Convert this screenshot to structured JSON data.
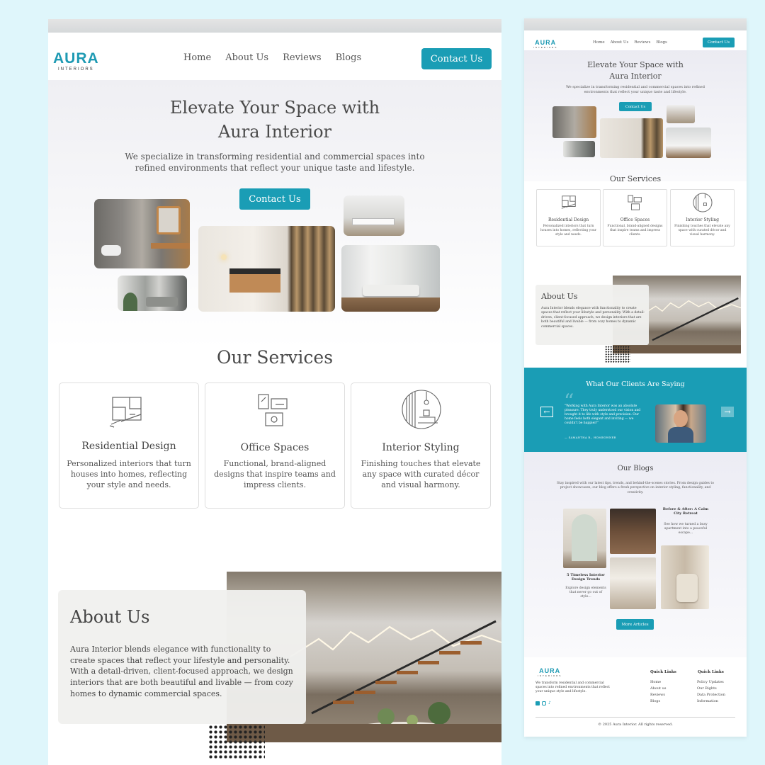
{
  "brand": {
    "name": "AURA",
    "tagline": "INTERIORS",
    "accent": "#1a9db5"
  },
  "nav": {
    "links": [
      "Home",
      "About Us",
      "Reviews",
      "Blogs"
    ],
    "cta": "Contact Us"
  },
  "hero": {
    "title_line1": "Elevate Your Space with",
    "title_line2": "Aura Interior",
    "subtitle": "We specialize in transforming residential and commercial spaces into refined environments that reflect your unique taste and lifestyle.",
    "cta": "Contact Us"
  },
  "services": {
    "title": "Our Services",
    "items": [
      {
        "icon": "floorplan-icon",
        "title": "Residential Design",
        "desc": "Personalized interiors that turn houses into homes, reflecting your style and needs."
      },
      {
        "icon": "office-furniture-icon",
        "title": "Office Spaces",
        "desc": "Functional, brand-aligned designs that inspire teams and impress clients."
      },
      {
        "icon": "styled-room-icon",
        "title": "Interior Styling",
        "desc": "Finishing touches that elevate any space with curated décor and visual harmony."
      }
    ]
  },
  "about": {
    "title": "About Us",
    "text": "Aura Interior blends elegance with functionality to create spaces that reflect your lifestyle and personality. With a detail-driven, client-focused approach, we design interiors that are both beautiful and livable — from cozy homes to dynamic commercial spaces."
  },
  "testimonials": {
    "title": "What Our Clients Are Saying",
    "quote": "\"Working with Aura Interior was an absolute pleasure. They truly understood our vision and brought it to life with style and precision. Our home feels both elegant and inviting — we couldn't be happier!\"",
    "author": "— SAMANTHA R., HOMEOWNER",
    "prev_icon": "arrow-left-icon",
    "next_icon": "arrow-right-icon"
  },
  "blogs": {
    "title": "Our Blogs",
    "intro": "Stay inspired with our latest tips, trends, and behind-the-scenes stories. From design guides to project showcases, our blog offers a fresh perspective on interior styling, functionality, and creativity.",
    "posts": [
      {
        "title": "5 Timeless Interior Design Trends",
        "desc": "Explore design elements that never go out of style..."
      },
      {
        "title": "Before & After: A Calm City Retreat",
        "desc": "See how we turned a busy apartment into a peaceful escape..."
      }
    ],
    "cta": "More Articles"
  },
  "footer": {
    "desc": "We transform residential and commercial spaces into refined environments that reflect your unique style and lifestyle.",
    "col1": {
      "title": "Quick Links",
      "links": [
        "Home",
        "About us",
        "Reviews",
        "Blogs"
      ]
    },
    "col2": {
      "title": "Quick Links",
      "links": [
        "Policy Updates",
        "Our Rights",
        "Data Protection",
        "Information"
      ]
    },
    "social": [
      "facebook-icon",
      "instagram-icon",
      "tiktok-icon"
    ],
    "copyright": "© 2025 Aura Interior. All rights reserved."
  }
}
